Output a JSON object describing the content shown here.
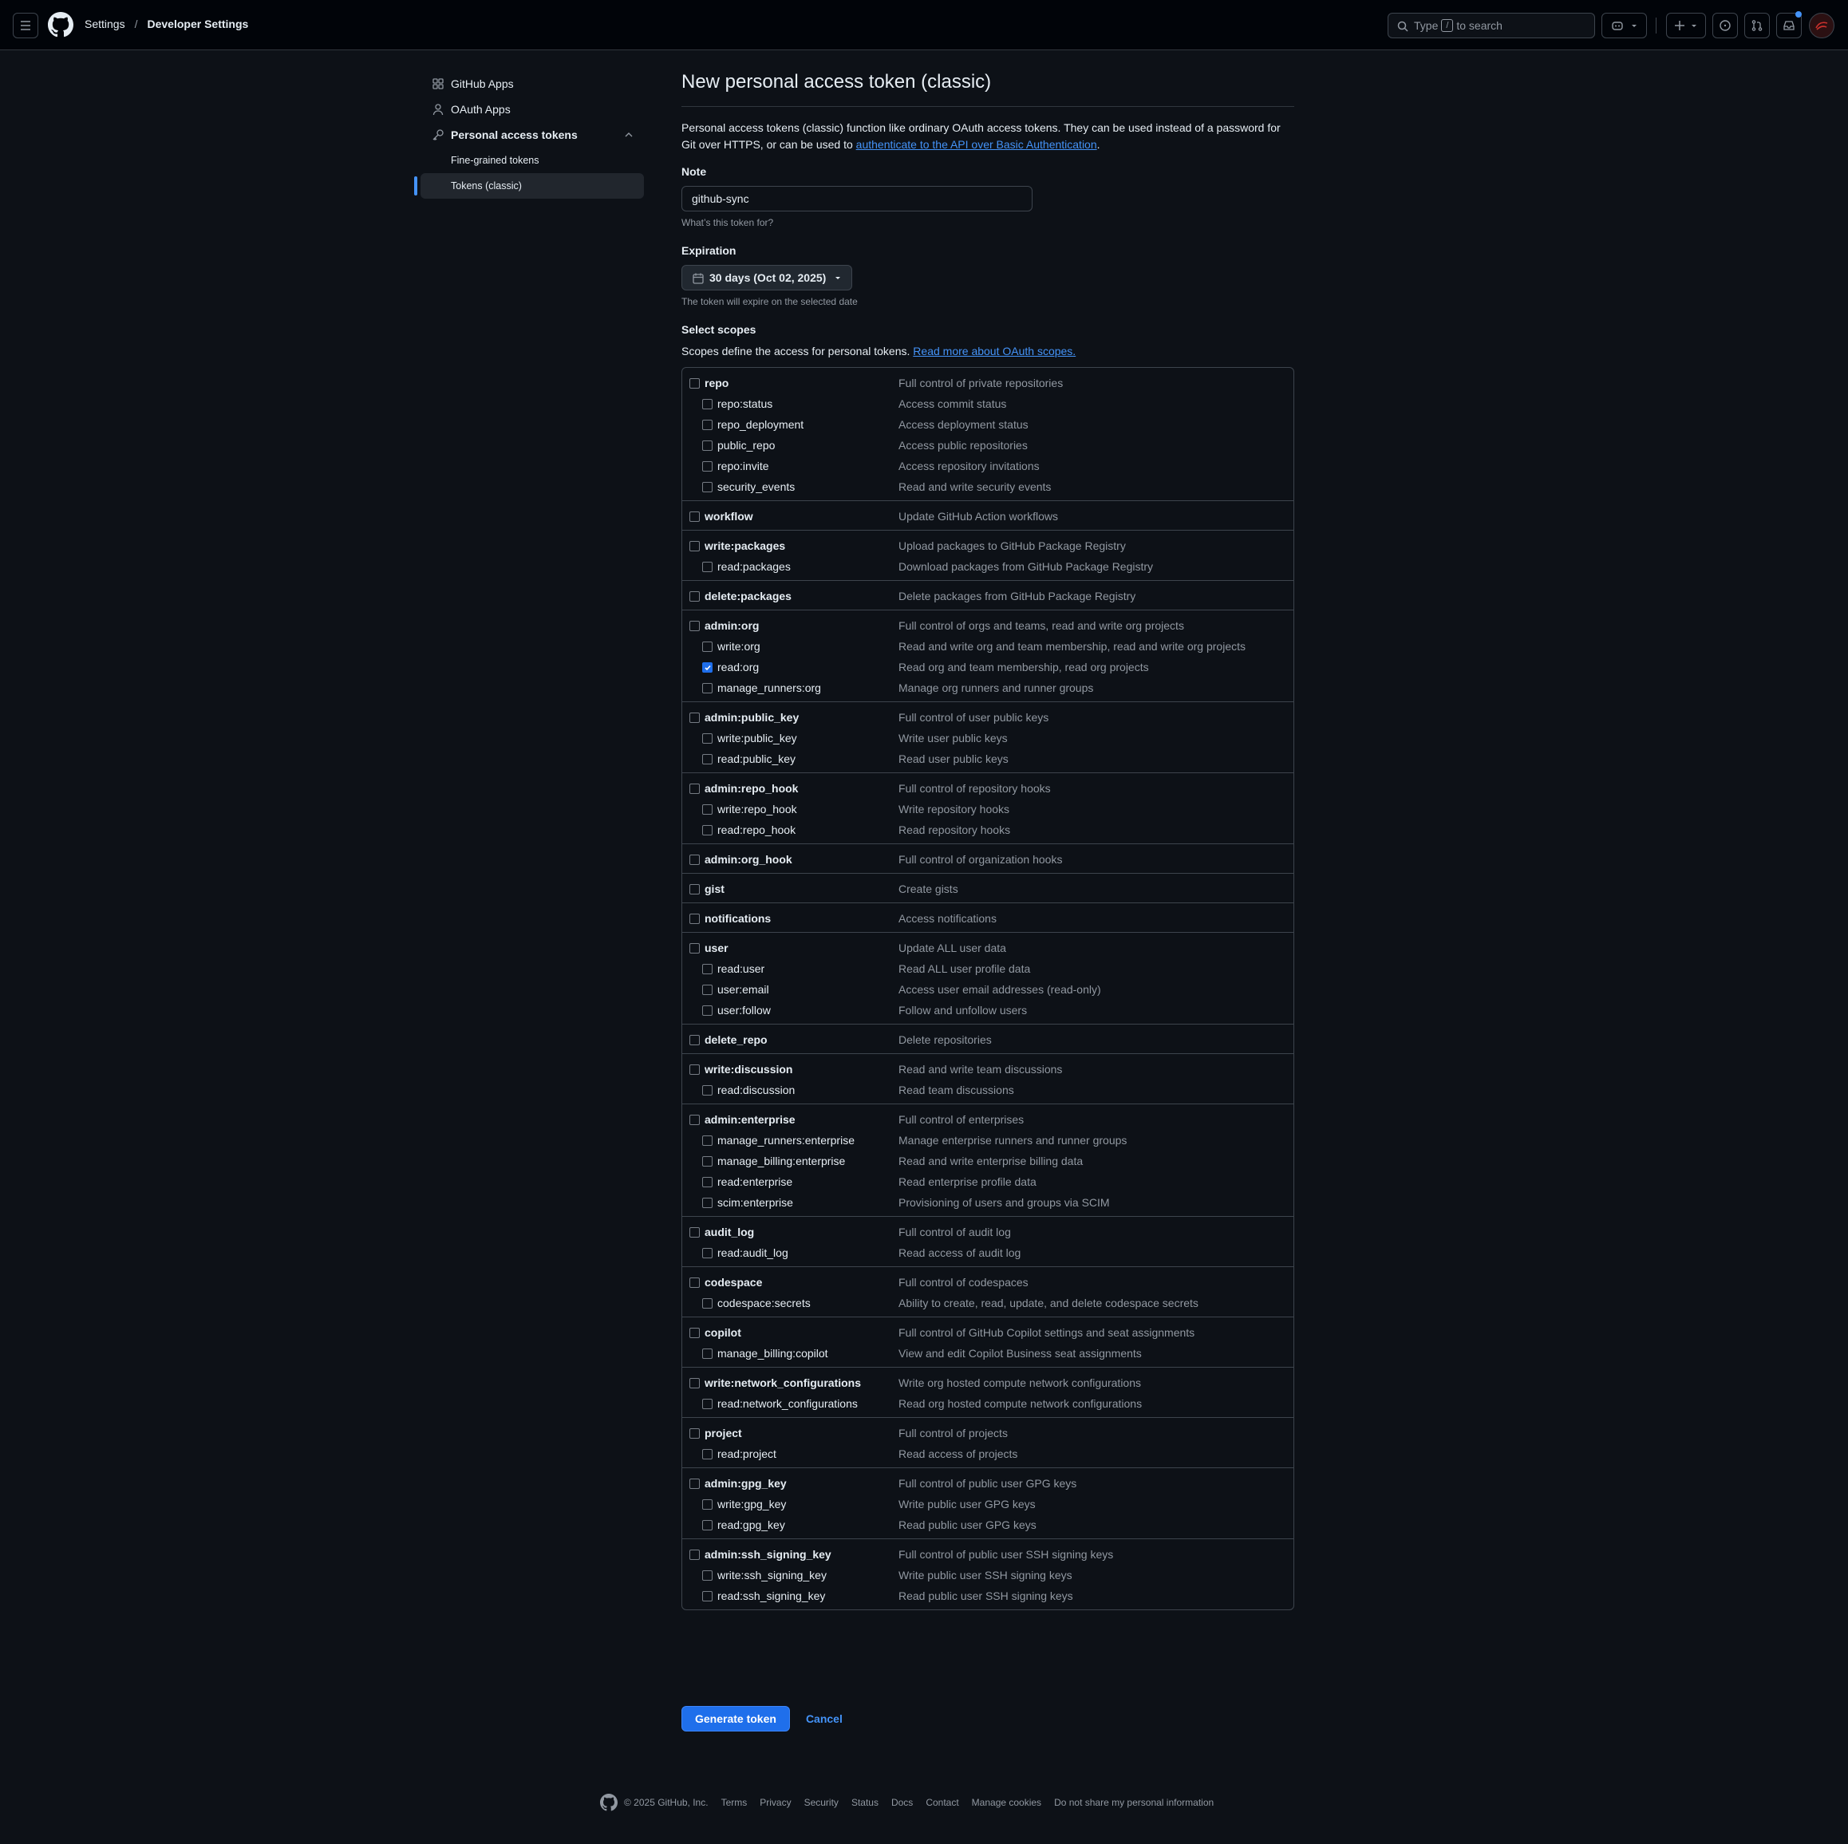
{
  "header": {
    "breadcrumbs": [
      "Settings",
      "Developer Settings"
    ],
    "search": {
      "prefix": "Type",
      "key": "/",
      "suffix": "to search"
    }
  },
  "sidebar": {
    "items": [
      {
        "label": "GitHub Apps",
        "icon": "apps-icon"
      },
      {
        "label": "OAuth Apps",
        "icon": "person-icon"
      },
      {
        "label": "Personal access tokens",
        "icon": "key-icon"
      }
    ],
    "sub_items": [
      {
        "label": "Fine-grained tokens",
        "active": false
      },
      {
        "label": "Tokens (classic)",
        "active": true
      }
    ]
  },
  "main": {
    "title": "New personal access token (classic)",
    "intro_text": "Personal access tokens (classic) function like ordinary OAuth access tokens. They can be used instead of a password for Git over HTTPS, or can be used to",
    "intro_link": "authenticate to the API over Basic Authentication",
    "note_label": "Note",
    "note_value": "github-sync",
    "note_hint": "What’s this token for?",
    "expiration_label": "Expiration",
    "expiration_value": "30 days (Oct 02, 2025)",
    "expiration_hint": "The token will expire on the selected date",
    "scopes_label": "Select scopes",
    "scopes_desc": "Scopes define the access for personal tokens.",
    "scopes_link": "Read more about OAuth scopes.",
    "generate_label": "Generate token",
    "cancel_label": "Cancel"
  },
  "scopes": [
    {
      "name": "repo",
      "desc": "Full control of private repositories",
      "checked": false,
      "children": [
        {
          "name": "repo:status",
          "desc": "Access commit status",
          "checked": false
        },
        {
          "name": "repo_deployment",
          "desc": "Access deployment status",
          "checked": false
        },
        {
          "name": "public_repo",
          "desc": "Access public repositories",
          "checked": false
        },
        {
          "name": "repo:invite",
          "desc": "Access repository invitations",
          "checked": false
        },
        {
          "name": "security_events",
          "desc": "Read and write security events",
          "checked": false
        }
      ]
    },
    {
      "name": "workflow",
      "desc": "Update GitHub Action workflows",
      "checked": false,
      "children": []
    },
    {
      "name": "write:packages",
      "desc": "Upload packages to GitHub Package Registry",
      "checked": false,
      "children": [
        {
          "name": "read:packages",
          "desc": "Download packages from GitHub Package Registry",
          "checked": false
        }
      ]
    },
    {
      "name": "delete:packages",
      "desc": "Delete packages from GitHub Package Registry",
      "checked": false,
      "children": []
    },
    {
      "name": "admin:org",
      "desc": "Full control of orgs and teams, read and write org projects",
      "checked": false,
      "children": [
        {
          "name": "write:org",
          "desc": "Read and write org and team membership, read and write org projects",
          "checked": false
        },
        {
          "name": "read:org",
          "desc": "Read org and team membership, read org projects",
          "checked": true
        },
        {
          "name": "manage_runners:org",
          "desc": "Manage org runners and runner groups",
          "checked": false
        }
      ]
    },
    {
      "name": "admin:public_key",
      "desc": "Full control of user public keys",
      "checked": false,
      "children": [
        {
          "name": "write:public_key",
          "desc": "Write user public keys",
          "checked": false
        },
        {
          "name": "read:public_key",
          "desc": "Read user public keys",
          "checked": false
        }
      ]
    },
    {
      "name": "admin:repo_hook",
      "desc": "Full control of repository hooks",
      "checked": false,
      "children": [
        {
          "name": "write:repo_hook",
          "desc": "Write repository hooks",
          "checked": false
        },
        {
          "name": "read:repo_hook",
          "desc": "Read repository hooks",
          "checked": false
        }
      ]
    },
    {
      "name": "admin:org_hook",
      "desc": "Full control of organization hooks",
      "checked": false,
      "children": []
    },
    {
      "name": "gist",
      "desc": "Create gists",
      "checked": false,
      "children": []
    },
    {
      "name": "notifications",
      "desc": "Access notifications",
      "checked": false,
      "children": []
    },
    {
      "name": "user",
      "desc": "Update ALL user data",
      "checked": false,
      "children": [
        {
          "name": "read:user",
          "desc": "Read ALL user profile data",
          "checked": false
        },
        {
          "name": "user:email",
          "desc": "Access user email addresses (read-only)",
          "checked": false
        },
        {
          "name": "user:follow",
          "desc": "Follow and unfollow users",
          "checked": false
        }
      ]
    },
    {
      "name": "delete_repo",
      "desc": "Delete repositories",
      "checked": false,
      "children": []
    },
    {
      "name": "write:discussion",
      "desc": "Read and write team discussions",
      "checked": false,
      "children": [
        {
          "name": "read:discussion",
          "desc": "Read team discussions",
          "checked": false
        }
      ]
    },
    {
      "name": "admin:enterprise",
      "desc": "Full control of enterprises",
      "checked": false,
      "children": [
        {
          "name": "manage_runners:enterprise",
          "desc": "Manage enterprise runners and runner groups",
          "checked": false
        },
        {
          "name": "manage_billing:enterprise",
          "desc": "Read and write enterprise billing data",
          "checked": false
        },
        {
          "name": "read:enterprise",
          "desc": "Read enterprise profile data",
          "checked": false
        },
        {
          "name": "scim:enterprise",
          "desc": "Provisioning of users and groups via SCIM",
          "checked": false
        }
      ]
    },
    {
      "name": "audit_log",
      "desc": "Full control of audit log",
      "checked": false,
      "children": [
        {
          "name": "read:audit_log",
          "desc": "Read access of audit log",
          "checked": false
        }
      ]
    },
    {
      "name": "codespace",
      "desc": "Full control of codespaces",
      "checked": false,
      "children": [
        {
          "name": "codespace:secrets",
          "desc": "Ability to create, read, update, and delete codespace secrets",
          "checked": false
        }
      ]
    },
    {
      "name": "copilot",
      "desc": "Full control of GitHub Copilot settings and seat assignments",
      "checked": false,
      "children": [
        {
          "name": "manage_billing:copilot",
          "desc": "View and edit Copilot Business seat assignments",
          "checked": false
        }
      ]
    },
    {
      "name": "write:network_configurations",
      "desc": "Write org hosted compute network configurations",
      "checked": false,
      "children": [
        {
          "name": "read:network_configurations",
          "desc": "Read org hosted compute network configurations",
          "checked": false
        }
      ]
    },
    {
      "name": "project",
      "desc": "Full control of projects",
      "checked": false,
      "children": [
        {
          "name": "read:project",
          "desc": "Read access of projects",
          "checked": false
        }
      ]
    },
    {
      "name": "admin:gpg_key",
      "desc": "Full control of public user GPG keys",
      "checked": false,
      "children": [
        {
          "name": "write:gpg_key",
          "desc": "Write public user GPG keys",
          "checked": false
        },
        {
          "name": "read:gpg_key",
          "desc": "Read public user GPG keys",
          "checked": false
        }
      ]
    },
    {
      "name": "admin:ssh_signing_key",
      "desc": "Full control of public user SSH signing keys",
      "checked": false,
      "children": [
        {
          "name": "write:ssh_signing_key",
          "desc": "Write public user SSH signing keys",
          "checked": false
        },
        {
          "name": "read:ssh_signing_key",
          "desc": "Read public user SSH signing keys",
          "checked": false
        }
      ]
    }
  ],
  "footer": {
    "copyright": "© 2025 GitHub, Inc.",
    "links": [
      "Terms",
      "Privacy",
      "Security",
      "Status",
      "Docs",
      "Contact",
      "Manage cookies",
      "Do not share my personal information"
    ]
  },
  "colors": {
    "accent": "#4493f8",
    "button": "#1f6feb",
    "background": "#0d1117"
  }
}
